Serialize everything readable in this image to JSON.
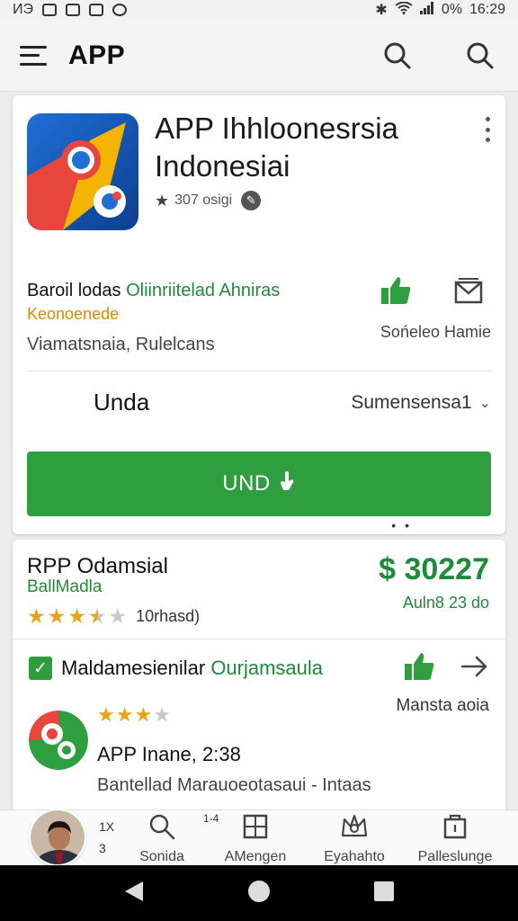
{
  "status_bar": {
    "left_text": "ИЭ",
    "battery": "0%",
    "time": "16:29"
  },
  "app_bar": {
    "title": "APP"
  },
  "app_card": {
    "name": "APP Ihhloonesrsia Indonesiai",
    "rating_text": "307 osigi",
    "developer": "Baroil lodas",
    "developer_link": "Oliinriitelad Ahniras",
    "category": "Keonoenede",
    "location": "Viamatsnaia, Rulelcans",
    "share_label": "Sońeleo Hamie",
    "version_label": "Unda",
    "version_select": "Sumensensa1",
    "install_label": "UND",
    "dots": "• •"
  },
  "details_card": {
    "title": "RPP Odamsial",
    "subtitle": "BallMadla",
    "rating_value": 3.5,
    "rating_count": "10rhasd)",
    "price": "$ 30227",
    "date": "Auln8 23 do",
    "check_text": "Maldamesienilar",
    "check_link": "Ourjamsaula",
    "row_label": "Mansta aoia",
    "mini_stars": 3,
    "app_version": "APP Inane, 2:38",
    "description": "Bantellad Marauoeotasaui - Intaas"
  },
  "bottom_nav": {
    "side_top": "1X",
    "side_bottom": "3",
    "badge": "1-4",
    "items": [
      {
        "label": "Sonida",
        "icon": "search-icon"
      },
      {
        "label": "AMengen",
        "icon": "grid-icon"
      },
      {
        "label": "Eyahahto",
        "icon": "crown-icon"
      },
      {
        "label": "Palleslunge",
        "icon": "library-icon"
      }
    ]
  },
  "colors": {
    "accent_green": "#2e9e3f",
    "star": "#e8a317",
    "orange": "#d98a00"
  }
}
